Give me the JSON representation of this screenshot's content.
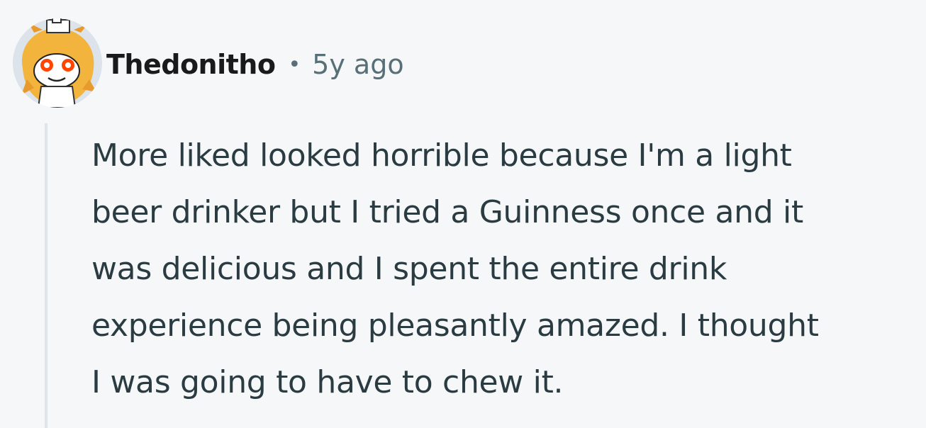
{
  "comment": {
    "author": "Thedonitho",
    "separator": "•",
    "timestamp": "5y ago",
    "body": "More liked looked horrible because I'm a light\nbeer drinker but I tried a Guinness once and it\nwas delicious and I spent the entire drink\nexperience being pleasantly amazed. I thought\nI was going to have to chew it.",
    "avatar_icon": "snoo-lion-avatar-icon"
  },
  "colors": {
    "background": "#f6f7f8",
    "author_text": "#1a1a1b",
    "meta_text": "#576f76",
    "body_text": "#2a3c42",
    "thread_line": "#e0e5e9",
    "avatar_fur": "#f2b43c"
  }
}
